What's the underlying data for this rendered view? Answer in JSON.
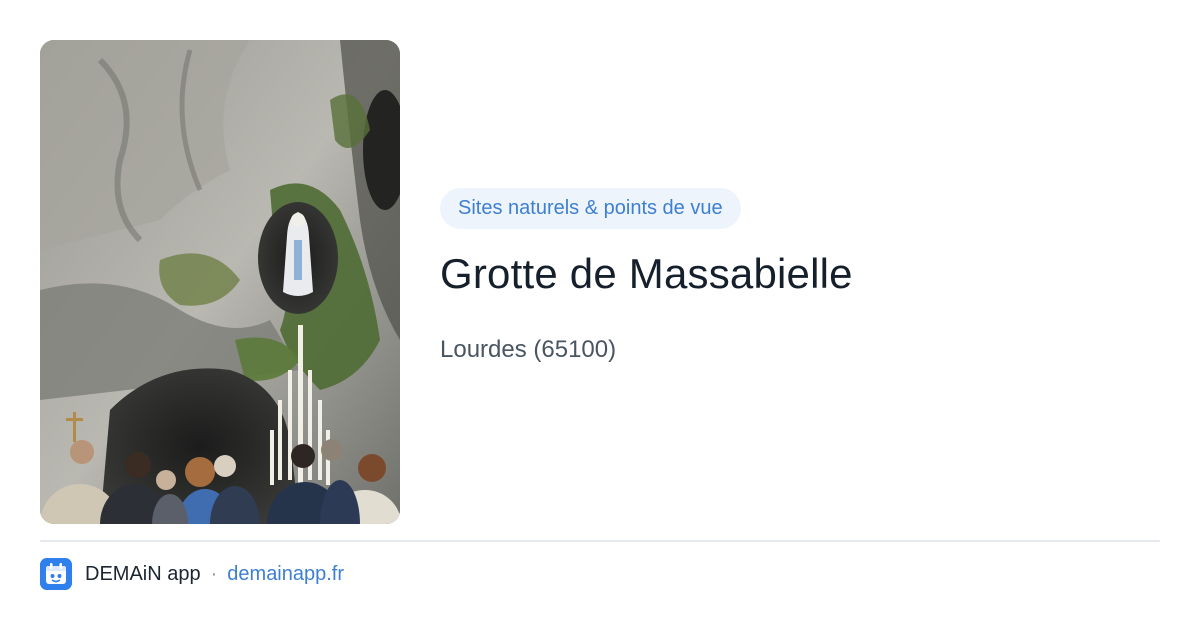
{
  "card": {
    "category": "Sites naturels & points de vue",
    "title": "Grotte de Massabielle",
    "location": "Lourdes (65100)"
  },
  "footer": {
    "app_name": "DEMAiN app",
    "separator": "·",
    "domain": "demainapp.fr"
  },
  "icons": {
    "app_logo": "demain-app-logo-icon"
  },
  "colors": {
    "accent": "#3d7fd1",
    "pill_background": "#eef4fc",
    "title_text": "#16202c",
    "subtitle_text": "#4a5563",
    "divider": "#e3e9ef",
    "app_icon_background": "#2f80ed"
  }
}
